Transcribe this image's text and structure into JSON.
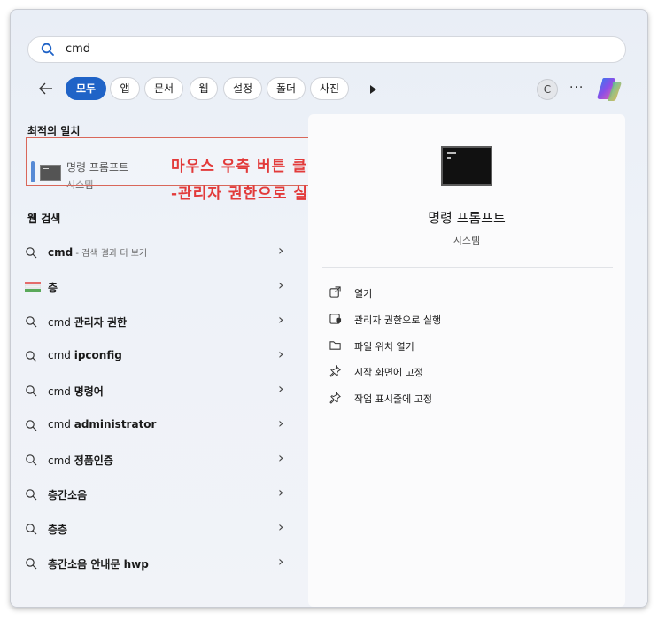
{
  "search": {
    "query": "cmd"
  },
  "filters": [
    {
      "label": "모두",
      "active": true
    },
    {
      "label": "앱"
    },
    {
      "label": "문서"
    },
    {
      "label": "웹"
    },
    {
      "label": "설정"
    },
    {
      "label": "폴더"
    },
    {
      "label": "사진"
    }
  ],
  "account_initial": "C",
  "more_label": "···",
  "best_match": {
    "section_title": "최적의 일치",
    "title": "명령 프롬프트",
    "subtitle": "시스템"
  },
  "callout": {
    "line1": "마우스 우측 버튼 클릭",
    "line2": "-관리자 권한으로 실행",
    "color": "#e23a3a"
  },
  "web_search": {
    "section_title": "웹 검색",
    "items": [
      {
        "icon": "search-icon",
        "plain": "cmd",
        "bold": "",
        "hint": " - 검색 결과 더 보기",
        "first_bold": true
      },
      {
        "icon": "layered-cake-icon",
        "plain": "",
        "bold": "층",
        "hint": ""
      },
      {
        "icon": "search-icon",
        "plain": "cmd ",
        "bold": "관리자 권한",
        "hint": ""
      },
      {
        "icon": "search-icon",
        "plain": "cmd ",
        "bold": "ipconfig",
        "hint": ""
      },
      {
        "icon": "search-icon",
        "plain": "cmd ",
        "bold": "명령어",
        "hint": ""
      },
      {
        "icon": "search-icon",
        "plain": "cmd ",
        "bold": "administrator",
        "hint": ""
      },
      {
        "icon": "search-icon",
        "plain": "cmd ",
        "bold": "정품인증",
        "hint": ""
      },
      {
        "icon": "search-icon",
        "plain": "",
        "bold": "층간소음",
        "hint": ""
      },
      {
        "icon": "search-icon",
        "plain": "",
        "bold": "층층",
        "hint": ""
      },
      {
        "icon": "search-icon",
        "plain": "",
        "bold": "층간소음 안내문 hwp",
        "hint": ""
      }
    ]
  },
  "details": {
    "title": "명령 프롬프트",
    "subtitle": "시스템",
    "actions": [
      {
        "icon": "open-icon",
        "label": "열기"
      },
      {
        "icon": "admin-shield-icon",
        "label": "관리자 권한으로 실행"
      },
      {
        "icon": "folder-icon",
        "label": "파일 위치 열기"
      },
      {
        "icon": "pin-icon",
        "label": "시작 화면에 고정"
      },
      {
        "icon": "pin-icon",
        "label": "작업 표시줄에 고정"
      }
    ]
  },
  "colors": {
    "accent": "#1f63c7",
    "callout_border": "#d9675a"
  }
}
